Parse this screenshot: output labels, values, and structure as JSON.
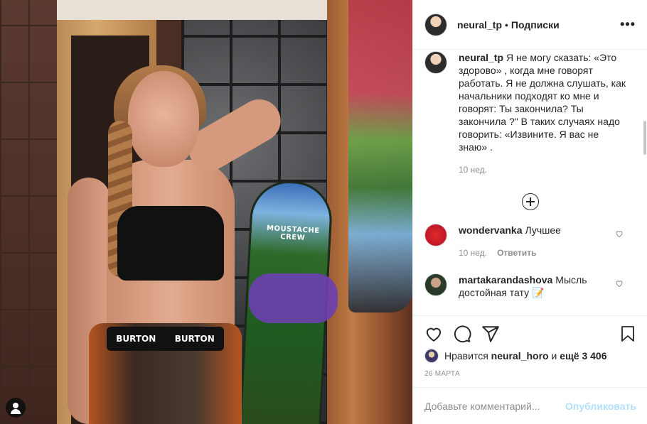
{
  "post": {
    "author": "neural_tp",
    "separator": "•",
    "follow_label": "Подписки",
    "more_label": "•••"
  },
  "photo": {
    "board_text": "MOUSTACHE CREW",
    "waistband_left": "BURTON",
    "waistband_right": "BURTON"
  },
  "caption": {
    "user": "neural_tp",
    "text": "Я не могу сказать: «Это здорово» , когда мне говорят работать. Я не должна слушать, как начальники подходят ко мне и говорят: Ты закончила? Ты закончила ?\" В таких случаях надо говорить: «Извините. Я вас не знаю» .",
    "time": "10 нед."
  },
  "comments": [
    {
      "user": "wondervanka",
      "text": "Лучшее",
      "time": "10 нед.",
      "reply": "Ответить"
    },
    {
      "user": "martakarandashova",
      "text": "Мысль достойная тату 📝"
    }
  ],
  "likes": {
    "prefix": "Нравится",
    "user": "neural_horo",
    "middle": "и",
    "count": "ещё 3 406"
  },
  "date": "26 МАРТА",
  "add_comment": {
    "placeholder": "Добавьте комментарий...",
    "publish": "Опубликовать"
  },
  "colors": {
    "text": "#262626",
    "muted": "#8e8e8e",
    "border": "#efefef",
    "publish_disabled": "#b2dffc"
  },
  "icons": [
    "heart-icon",
    "comment-icon",
    "share-icon",
    "bookmark-icon",
    "plus-circle-icon",
    "user-tag-icon",
    "more-icon"
  ]
}
